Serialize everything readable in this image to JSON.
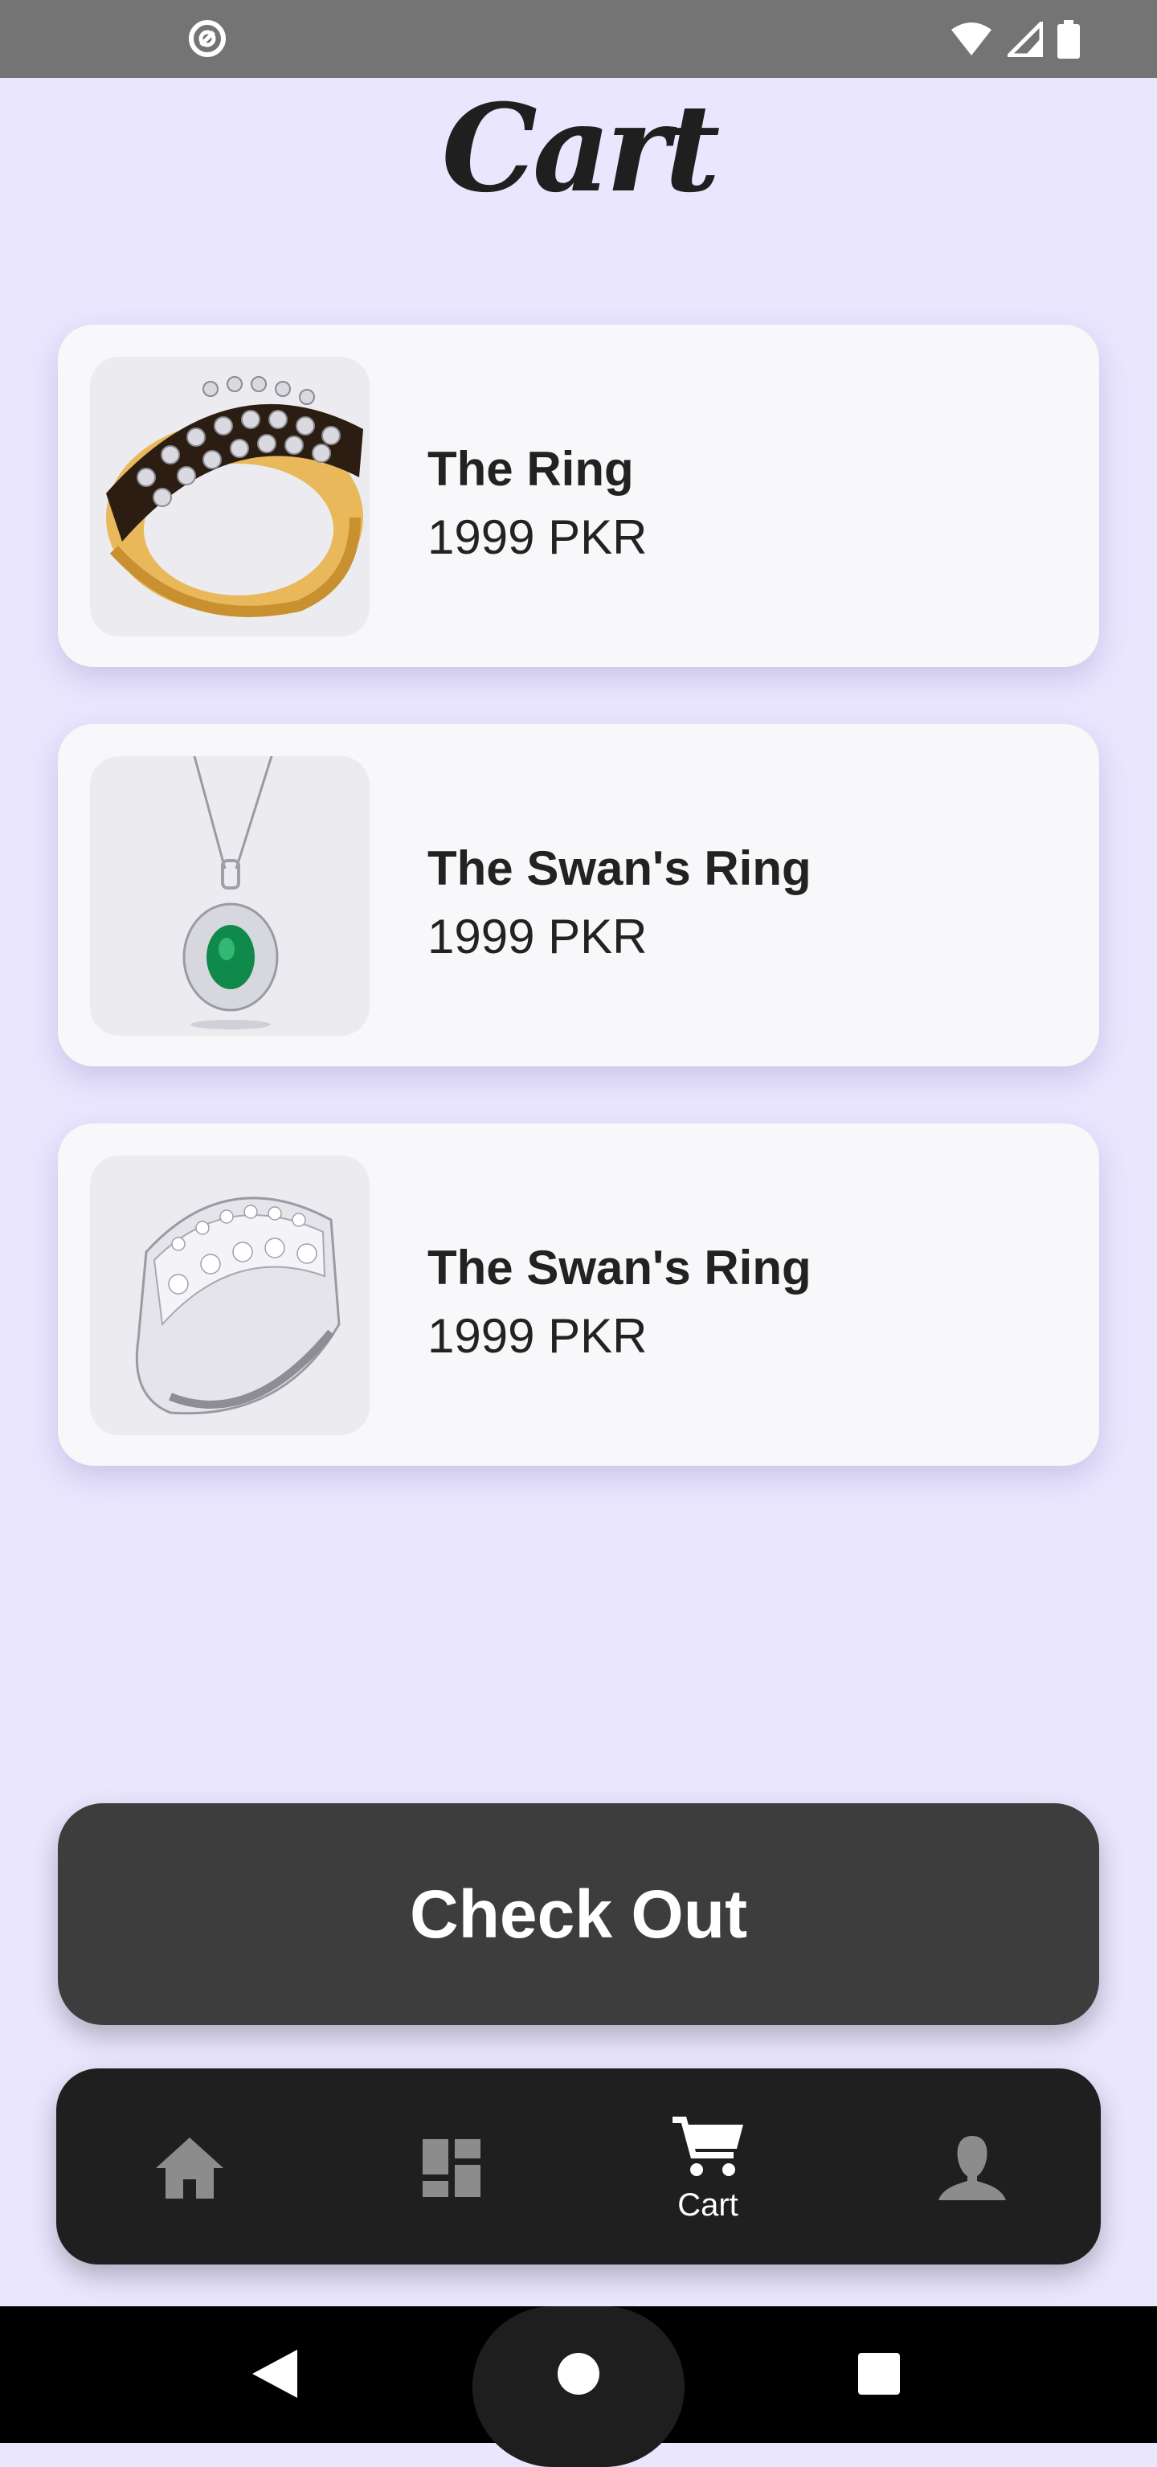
{
  "page": {
    "title": "Cart"
  },
  "cart_items": [
    {
      "name": "The Ring",
      "price": "1999 PKR",
      "image": "gold-diamond-ring"
    },
    {
      "name": "The Swan's Ring",
      "price": "1999 PKR",
      "image": "emerald-pendant-necklace"
    },
    {
      "name": "The Swan's Ring",
      "price": "1999 PKR",
      "image": "silver-diamond-ring"
    }
  ],
  "checkout": {
    "label": "Check Out"
  },
  "nav": {
    "items": [
      {
        "icon": "home-icon"
      },
      {
        "icon": "dashboard-icon"
      },
      {
        "icon": "cart-icon",
        "label": "Cart",
        "active": true
      },
      {
        "icon": "profile-icon"
      }
    ]
  },
  "colors": {
    "background": "#E9E6FE",
    "card": "#F8F8FA",
    "checkout": "#3D3D3D",
    "nav": "#1F1F1F"
  }
}
